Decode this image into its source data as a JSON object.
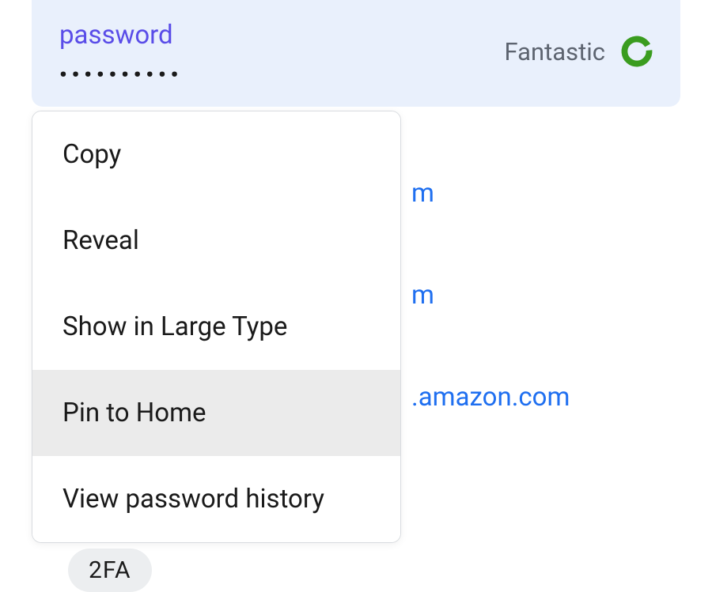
{
  "password_field": {
    "label": "password",
    "masked_value": "••••••••••",
    "strength_label": "Fantastic",
    "strength_color": "#3a9c1f"
  },
  "context_menu": {
    "items": [
      {
        "label": "Copy",
        "hovered": false
      },
      {
        "label": "Reveal",
        "hovered": false
      },
      {
        "label": "Show in Large Type",
        "hovered": false
      },
      {
        "label": "Pin to Home",
        "hovered": true
      },
      {
        "label": "View password history",
        "hovered": false
      }
    ]
  },
  "background_fields": [
    {
      "value": "m",
      "partial": true
    },
    {
      "value": "m",
      "partial": true
    },
    {
      "value": ".amazon.com",
      "partial": true
    }
  ],
  "tag": {
    "label": "2FA"
  }
}
